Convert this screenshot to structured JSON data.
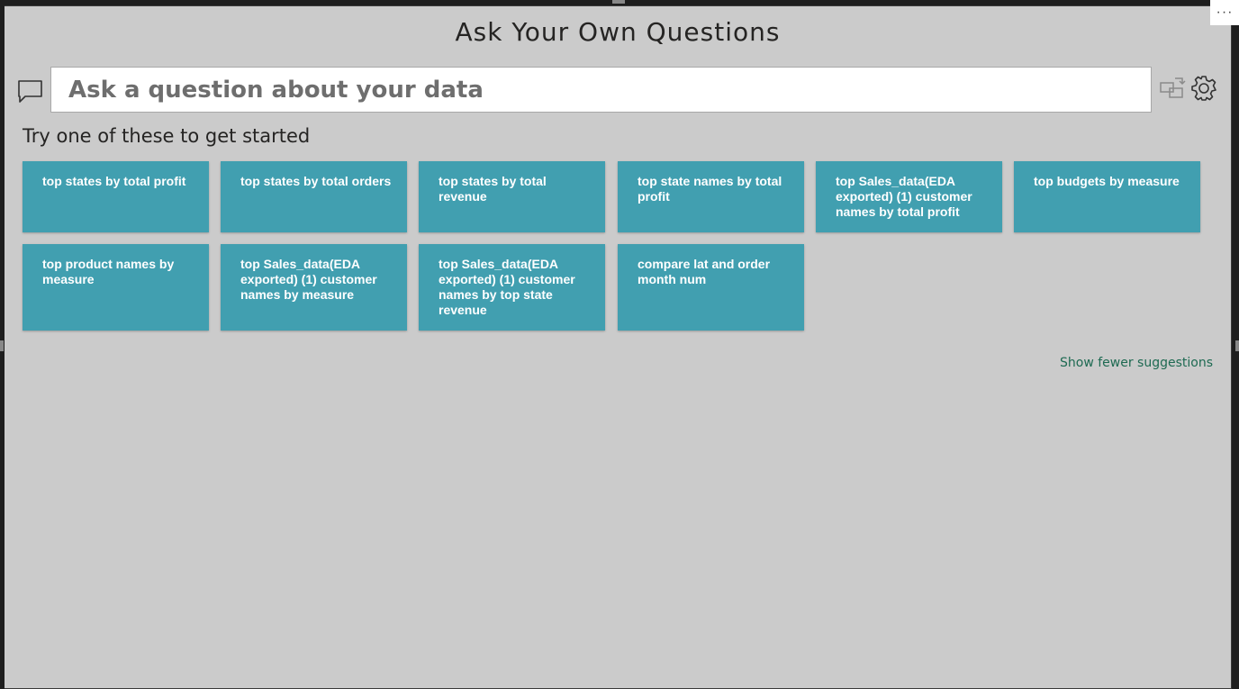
{
  "header": {
    "title": "Ask Your Own Questions",
    "more_options": "···"
  },
  "qna": {
    "placeholder": "Ask a question about your data",
    "prompt": "Try one of these to get started",
    "suggestions": [
      "top states by total profit",
      "top states by total orders",
      "top states by total revenue",
      "top state names by total profit",
      "top Sales_data(EDA exported) (1) customer names by total profit",
      "top budgets by measure",
      "top product names by measure",
      "top Sales_data(EDA exported) (1) customer names by measure",
      "top Sales_data(EDA exported) (1) customer names by top state revenue",
      "compare lat and order month num"
    ],
    "show_fewer_label": "Show fewer suggestions"
  },
  "icons": {
    "chat": "chat-bubble-icon",
    "convert": "convert-to-visual-icon",
    "settings": "gear-icon"
  },
  "colors": {
    "card_background": "#419fb0",
    "visual_background": "#cbcbcb",
    "link": "#1e6a52"
  }
}
